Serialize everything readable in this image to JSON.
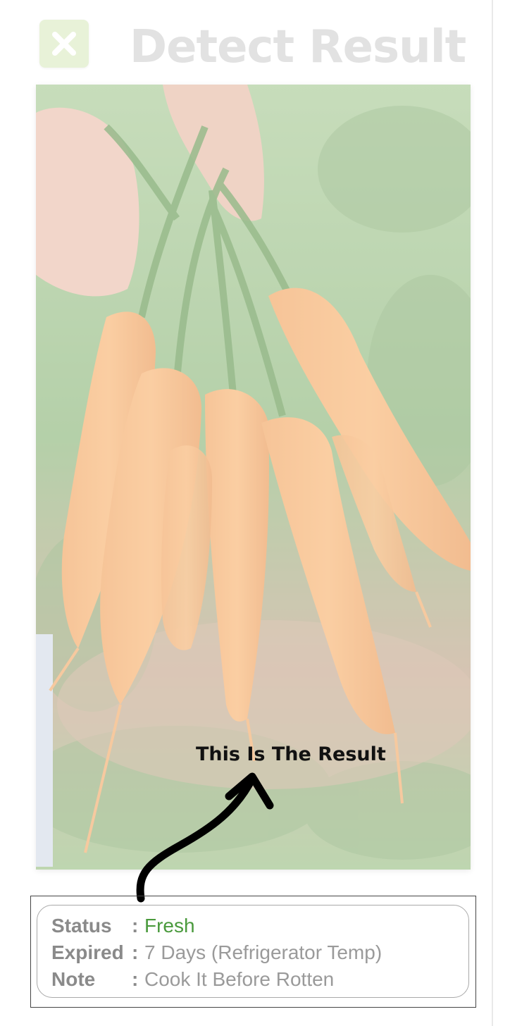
{
  "header": {
    "title": "Detect Result",
    "close_icon": "close-icon",
    "close_bg_color": "#e8f2d8"
  },
  "image": {
    "subject_icon": "carrot-bunch-photo"
  },
  "annotation": {
    "label": "This Is The Result",
    "arrow_icon": "curved-arrow-icon"
  },
  "result": {
    "rows": [
      {
        "key": "Status",
        "separator": ":",
        "value": "Fresh"
      },
      {
        "key": "Expired",
        "separator": ":",
        "value": "7 Days (Refrigerator Temp)"
      },
      {
        "key": "Note",
        "separator": ":",
        "value": "Cook It Before Rotten"
      }
    ],
    "status_color": "#4a9a3d"
  }
}
